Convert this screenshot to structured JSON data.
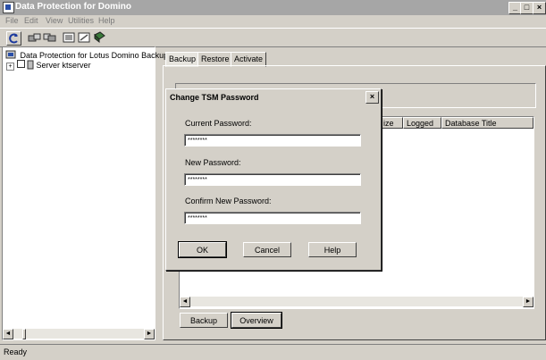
{
  "window": {
    "title": "Data Protection for Domino"
  },
  "menu": {
    "file": "File",
    "edit": "Edit",
    "view": "View",
    "utilities": "Utilities",
    "help": "Help"
  },
  "tree": {
    "root": "Data Protection for Lotus Domino Backup",
    "server": "Server ktserver"
  },
  "tabs": {
    "backup": "Backup",
    "restore": "Restore",
    "activate": "Activate"
  },
  "columns": {
    "size": "ize",
    "logged": "Logged",
    "db_title": "Database Title"
  },
  "buttons": {
    "backup": "Backup",
    "overview": "Overview"
  },
  "status": {
    "text": "Ready"
  },
  "dialog": {
    "title": "Change TSM Password",
    "current_label": "Current Password:",
    "current_value": "********",
    "new_label": "New Password:",
    "new_value": "********",
    "confirm_label": "Confirm New Password:",
    "confirm_value": "********",
    "ok": "OK",
    "cancel": "Cancel",
    "help": "Help",
    "close": "×"
  },
  "icons": [
    "refresh-icon",
    "backup-icon",
    "restore-icon",
    "list-icon",
    "properties-icon",
    "book-icon"
  ]
}
